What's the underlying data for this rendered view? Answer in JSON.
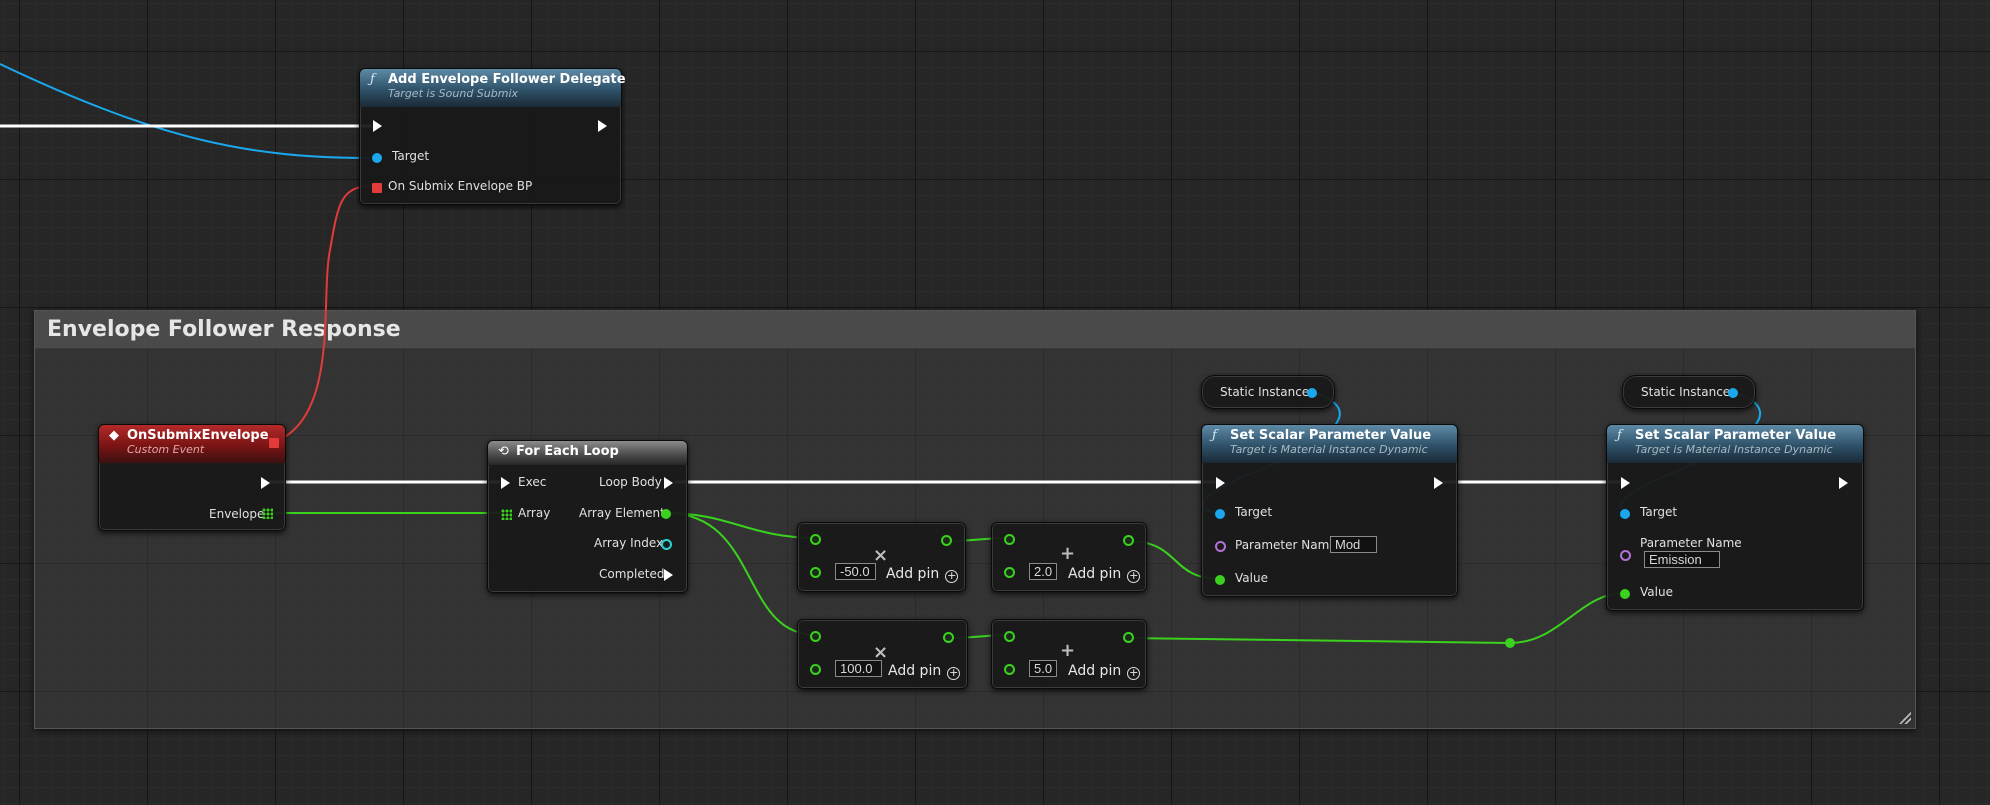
{
  "comment": {
    "title": "Envelope Follower Response"
  },
  "add_delegate": {
    "title": "Add Envelope Follower Delegate",
    "subtitle": "Target is Sound Submix",
    "target_label": "Target",
    "event_label": "On Submix Envelope BP"
  },
  "event_node": {
    "title": "OnSubmixEnvelope",
    "subtitle": "Custom Event",
    "envelope_label": "Envelope"
  },
  "loop_node": {
    "title": "For Each Loop",
    "exec_label": "Exec",
    "array_label": "Array",
    "loop_body_label": "Loop Body",
    "array_element_label": "Array Element",
    "array_index_label": "Array Index",
    "completed_label": "Completed"
  },
  "math_nodes": [
    {
      "op": "×",
      "value": "-50.0",
      "add_pin": "Add pin"
    },
    {
      "op": "+",
      "value": "2.0",
      "add_pin": "Add pin"
    },
    {
      "op": "×",
      "value": "100.0",
      "add_pin": "Add pin"
    },
    {
      "op": "+",
      "value": "5.0",
      "add_pin": "Add pin"
    }
  ],
  "static_instance_label": "Static Instance",
  "set_scalar_1": {
    "title": "Set Scalar Parameter Value",
    "subtitle": "Target is Material Instance Dynamic",
    "target_label": "Target",
    "param_label": "Parameter Name",
    "param_value": "Mod",
    "value_label": "Value"
  },
  "set_scalar_2": {
    "title": "Set Scalar Parameter Value",
    "subtitle": "Target is Material Instance Dynamic",
    "target_label": "Target",
    "param_label": "Parameter Name",
    "param_value": "Emission",
    "value_label": "Value"
  },
  "colors": {
    "exec_wire": "#ffffff",
    "object_wire": "#1aa7ec",
    "float_wire": "#3ad11f",
    "delegate_wire": "#e23b3b"
  }
}
